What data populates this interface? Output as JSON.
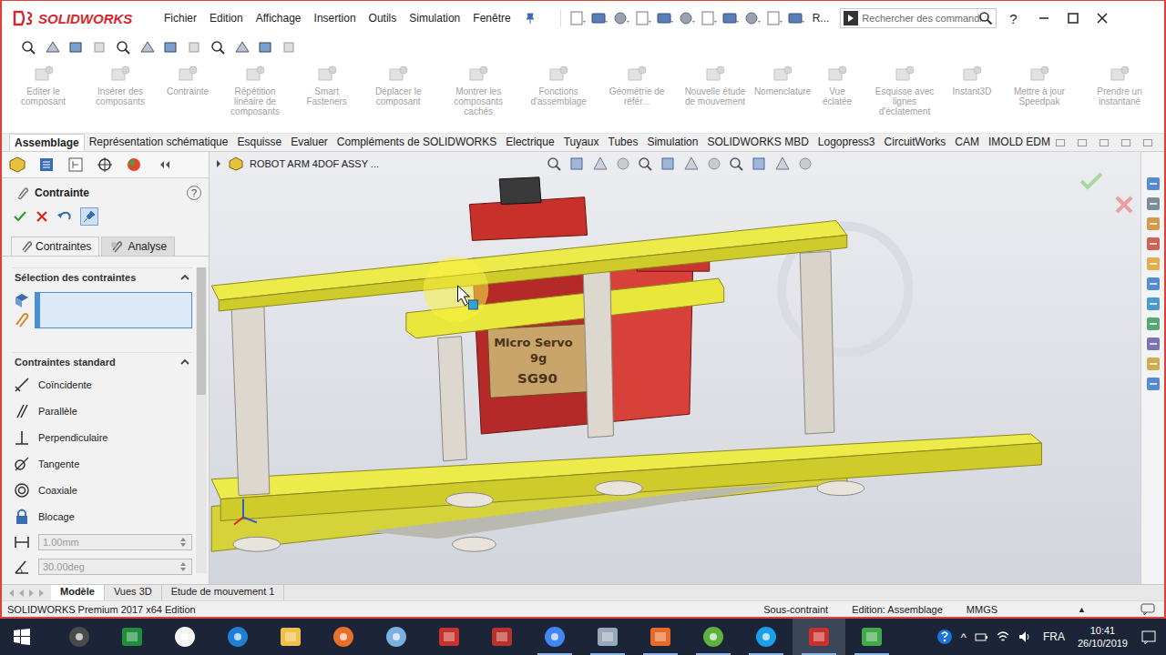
{
  "app": {
    "logo": "SOLIDWORKS"
  },
  "menu": [
    "Fichier",
    "Edition",
    "Affichage",
    "Insertion",
    "Outils",
    "Simulation",
    "Fenêtre"
  ],
  "title_bar": {
    "truncated_label": "R...",
    "help": "?"
  },
  "search": {
    "placeholder": "Rechercher des commandi"
  },
  "command_manager": [
    {
      "label": "Editer le composant",
      "disabled": true
    },
    {
      "label": "Insérer des composants",
      "disabled": true
    },
    {
      "label": "Contrainte",
      "disabled": true
    },
    {
      "label": "Répétition linéaire de composants",
      "disabled": true
    },
    {
      "label": "Smart Fasteners",
      "disabled": true
    },
    {
      "label": "Déplacer le composant",
      "disabled": true
    },
    {
      "label": "Montrer les composants cachés",
      "disabled": true
    },
    {
      "label": "Fonctions d'assemblage",
      "disabled": true
    },
    {
      "label": "Géométrie de référ...",
      "disabled": true
    },
    {
      "label": "Nouvelle étude de mouvement",
      "disabled": true
    },
    {
      "label": "Nomenclature",
      "disabled": true
    },
    {
      "label": "Vue éclatée",
      "disabled": true
    },
    {
      "label": "Esquisse avec lignes d'éclatement",
      "disabled": true
    },
    {
      "label": "Instant3D",
      "disabled": true
    },
    {
      "label": "Mettre à jour Speedpak",
      "disabled": true
    },
    {
      "label": "Prendre un instantané",
      "disabled": true
    }
  ],
  "ribbon_tabs": [
    {
      "label": "Assemblage",
      "selected": true
    },
    {
      "label": "Représentation schématique",
      "selected": false
    },
    {
      "label": "Esquisse",
      "selected": false
    },
    {
      "label": "Evaluer",
      "selected": false
    },
    {
      "label": "Compléments de SOLIDWORKS",
      "selected": false
    },
    {
      "label": "Electrique",
      "selected": false
    },
    {
      "label": "Tuyaux",
      "selected": false
    },
    {
      "label": "Tubes",
      "selected": false
    },
    {
      "label": "Simulation",
      "selected": false
    },
    {
      "label": "SOLIDWORKS MBD",
      "selected": false
    },
    {
      "label": "Logopress3",
      "selected": false
    },
    {
      "label": "CircuitWorks",
      "selected": false
    },
    {
      "label": "CAM",
      "selected": false
    },
    {
      "label": "IMOLD EDM",
      "selected": false
    }
  ],
  "property_manager": {
    "title": "Contrainte",
    "help": "?",
    "subtabs": [
      {
        "label": "Contraintes",
        "selected": true
      },
      {
        "label": "Analyse",
        "selected": false
      }
    ],
    "selection_section": {
      "title": "Sélection des contraintes",
      "expanded": true,
      "field_value": ""
    },
    "standard_section": {
      "title": "Contraintes standard",
      "expanded": true,
      "mates": [
        {
          "label": "Coïncidente",
          "disabled": false
        },
        {
          "label": "Parallèle",
          "disabled": false
        },
        {
          "label": "Perpendiculaire",
          "disabled": false
        },
        {
          "label": "Tangente",
          "disabled": false
        },
        {
          "label": "Coaxiale",
          "disabled": false
        },
        {
          "label": "Blocage",
          "disabled": false
        }
      ],
      "distance": {
        "value": "1.00mm",
        "disabled": true
      },
      "angle": {
        "value": "30.00deg",
        "disabled": true
      }
    }
  },
  "viewport": {
    "breadcrumb": "ROBOT ARM 4DOF ASSY ...",
    "model_labels": [
      "Micro Servo",
      "9g",
      "SG90"
    ]
  },
  "bottom_tabs": [
    {
      "label": "Modèle",
      "selected": true
    },
    {
      "label": "Vues 3D",
      "selected": false
    },
    {
      "label": "Etude de mouvement 1",
      "selected": false
    }
  ],
  "status_bar": {
    "product": "SOLIDWORKS Premium 2017 x64 Edition",
    "constraint_state": "Sous-contraint",
    "mode": "Edition: Assemblage",
    "units": "MMGS",
    "units_caret": "▲"
  },
  "taskbar": {
    "apps": [
      {
        "running": false,
        "active": false
      },
      {
        "running": false,
        "active": false
      },
      {
        "running": false,
        "active": false
      },
      {
        "running": false,
        "active": false
      },
      {
        "running": false,
        "active": false
      },
      {
        "running": false,
        "active": false
      },
      {
        "running": false,
        "active": false
      },
      {
        "running": false,
        "active": false
      },
      {
        "running": false,
        "active": false
      },
      {
        "running": true,
        "active": false
      },
      {
        "running": true,
        "active": false
      },
      {
        "running": true,
        "active": false
      },
      {
        "running": true,
        "active": false
      },
      {
        "running": true,
        "active": false
      },
      {
        "running": true,
        "active": true
      },
      {
        "running": true,
        "active": false
      }
    ],
    "tray_caret": "^",
    "language": "FRA",
    "time": "10:41",
    "date": "26/10/2019"
  }
}
